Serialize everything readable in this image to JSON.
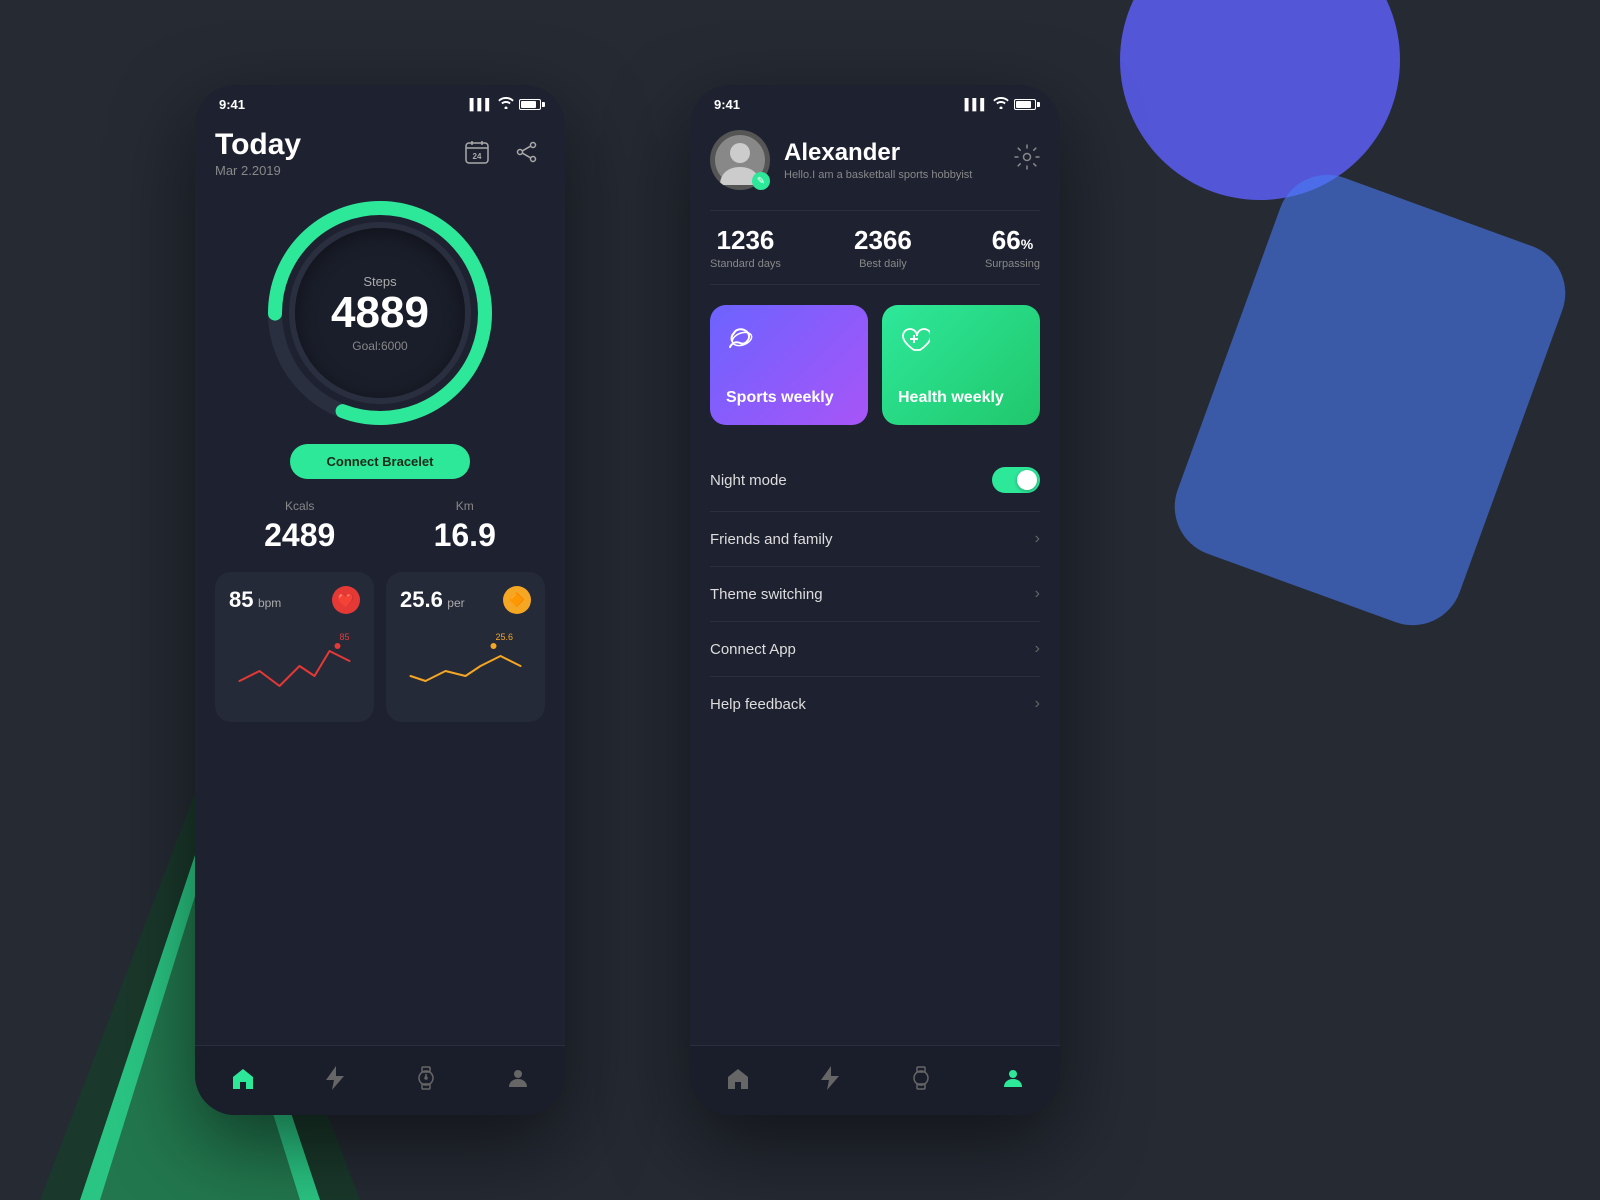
{
  "background": {
    "color": "#252a33"
  },
  "phone_left": {
    "status_bar": {
      "time": "9:41",
      "signal": "▌▌▌",
      "wifi": "wifi",
      "battery": "battery"
    },
    "header": {
      "title": "Today",
      "subtitle": "Mar 2.2019",
      "calendar_icon": "calendar-icon",
      "share_icon": "share-icon"
    },
    "steps": {
      "label": "Steps",
      "value": "4889",
      "goal": "Goal:6000"
    },
    "connect_btn": "Connect Bracelet",
    "kcals": {
      "label": "Kcals",
      "value": "2489"
    },
    "km": {
      "label": "Km",
      "value": "16.9"
    },
    "heart_card": {
      "value": "85",
      "unit": "bpm",
      "icon": "heart-icon"
    },
    "speed_card": {
      "value": "25.6",
      "unit": "per",
      "icon": "speed-icon"
    },
    "nav": {
      "home": "🏠",
      "lightning": "⚡",
      "watch": "⌚",
      "profile": "👤"
    }
  },
  "phone_right": {
    "status_bar": {
      "time": "9:41"
    },
    "profile": {
      "name": "Alexander",
      "bio": "Hello.I am a basketball sports hobbyist",
      "settings_icon": "settings-icon",
      "edit_icon": "edit-icon"
    },
    "stats": {
      "standard_days": {
        "value": "1236",
        "label": "Standard days"
      },
      "best_daily": {
        "value": "2366",
        "label": "Best daily"
      },
      "surpassing": {
        "value": "66",
        "unit": "%",
        "label": "Surpassing"
      }
    },
    "weekly_cards": {
      "sports": {
        "label": "Sports weekly",
        "icon": "shoe-icon"
      },
      "health": {
        "label": "Health weekly",
        "icon": "heart-plus-icon"
      }
    },
    "menu_items": [
      {
        "id": "night-mode",
        "label": "Night mode",
        "has_toggle": true
      },
      {
        "id": "friends-family",
        "label": "Friends and family",
        "has_toggle": false
      },
      {
        "id": "theme-switching",
        "label": "Theme switching",
        "has_toggle": false
      },
      {
        "id": "connect-app",
        "label": "Connect App",
        "has_toggle": false
      },
      {
        "id": "help-feedback",
        "label": "Help feedback",
        "has_toggle": false
      }
    ],
    "nav": {
      "home": "🏠",
      "lightning": "⚡",
      "watch": "⌚",
      "profile": "👤"
    }
  }
}
